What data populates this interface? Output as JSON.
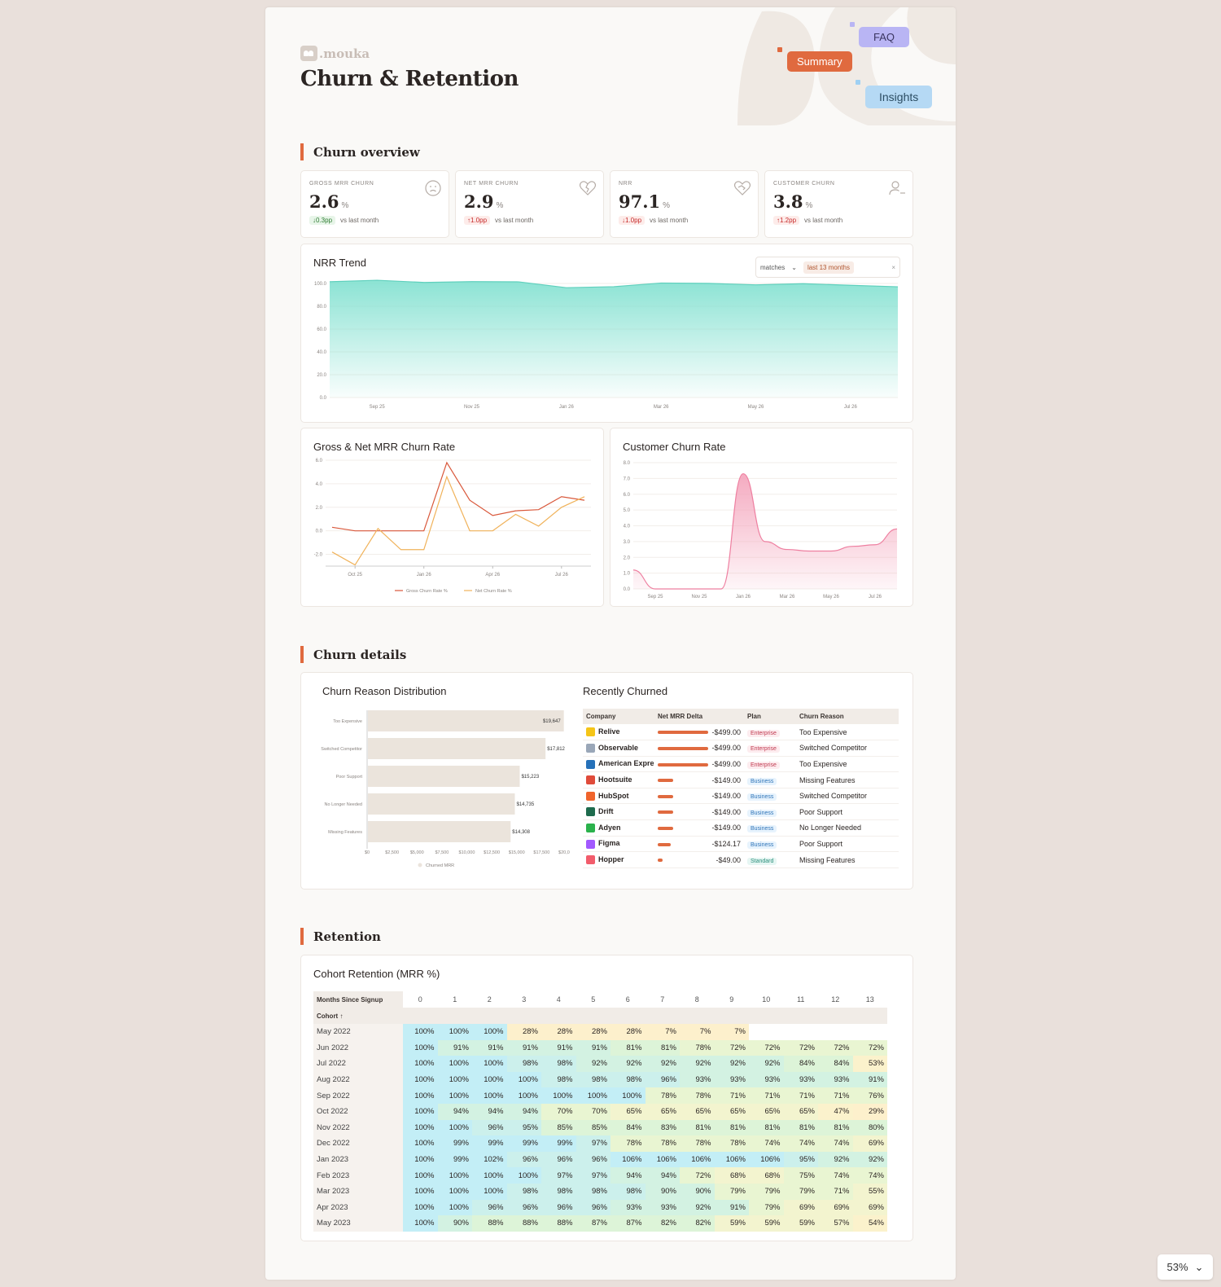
{
  "brand": {
    "name": ".mouka"
  },
  "page_title": "Churn & Retention",
  "nav_pills": {
    "summary": "Summary",
    "faq": "FAQ",
    "insights": "Insights"
  },
  "sections": {
    "overview": "Churn overview",
    "details": "Churn details",
    "retention": "Retention"
  },
  "kpis": [
    {
      "label": "GROSS MRR CHURN",
      "value": "2.6",
      "unit": "%",
      "delta": "↓0.3pp",
      "delta_tone": "good",
      "note": "vs last month",
      "icon": "sad-face-icon"
    },
    {
      "label": "NET MRR CHURN",
      "value": "2.9",
      "unit": "%",
      "delta": "↑1.0pp",
      "delta_tone": "bad",
      "note": "vs last month",
      "icon": "broken-heart-icon"
    },
    {
      "label": "NRR",
      "value": "97.1",
      "unit": "%",
      "delta": "↓1.0pp",
      "delta_tone": "bad",
      "note": "vs last month",
      "icon": "heart-handshake-icon"
    },
    {
      "label": "CUSTOMER CHURN",
      "value": "3.8",
      "unit": "%",
      "delta": "↑1.2pp",
      "delta_tone": "bad",
      "note": "vs last month",
      "icon": "user-minus-icon"
    }
  ],
  "nrr_trend": {
    "title": "NRR Trend",
    "filter_op": "matches",
    "filter_value": "last 13 months",
    "filter_clear": "×"
  },
  "churn_rate": {
    "title": "Gross & Net MRR Churn Rate"
  },
  "customer_churn": {
    "title": "Customer Churn Rate"
  },
  "reason_dist": {
    "title": "Churn Reason Distribution"
  },
  "recent": {
    "title": "Recently Churned",
    "columns": [
      "Company",
      "Net MRR Delta",
      "Plan",
      "Churn Reason"
    ],
    "rows": [
      {
        "company": "Relive",
        "delta": "-$499.00",
        "bar": 1.0,
        "plan": "Enterprise",
        "reason": "Too Expensive",
        "logo_color": "#f5c518"
      },
      {
        "company": "Observable",
        "delta": "-$499.00",
        "bar": 1.0,
        "plan": "Enterprise",
        "reason": "Switched Competitor",
        "logo_color": "#9aa7b8"
      },
      {
        "company": "American Express",
        "delta": "-$499.00",
        "bar": 1.0,
        "plan": "Enterprise",
        "reason": "Too Expensive",
        "logo_color": "#2671b9"
      },
      {
        "company": "Hootsuite",
        "delta": "-$149.00",
        "bar": 0.3,
        "plan": "Business",
        "reason": "Missing Features",
        "logo_color": "#e04b3a"
      },
      {
        "company": "HubSpot",
        "delta": "-$149.00",
        "bar": 0.3,
        "plan": "Business",
        "reason": "Switched Competitor",
        "logo_color": "#f0642c"
      },
      {
        "company": "Drift",
        "delta": "-$149.00",
        "bar": 0.3,
        "plan": "Business",
        "reason": "Poor Support",
        "logo_color": "#1e6b4d"
      },
      {
        "company": "Adyen",
        "delta": "-$149.00",
        "bar": 0.3,
        "plan": "Business",
        "reason": "No Longer Needed",
        "logo_color": "#2bb24c"
      },
      {
        "company": "Figma",
        "delta": "-$124.17",
        "bar": 0.25,
        "plan": "Business",
        "reason": "Poor Support",
        "logo_color": "#a259ff"
      },
      {
        "company": "Hopper",
        "delta": "-$49.00",
        "bar": 0.1,
        "plan": "Standard",
        "reason": "Missing Features",
        "logo_color": "#f25c6b"
      }
    ]
  },
  "cohort": {
    "title": "Cohort Retention (MRR %)",
    "header_label": "Months Since Signup",
    "cohort_label": "Cohort ↑",
    "months": [
      "0",
      "1",
      "2",
      "3",
      "4",
      "5",
      "6",
      "7",
      "8",
      "9",
      "10",
      "11",
      "12",
      "13"
    ],
    "rows": [
      {
        "cohort": "May 2022",
        "values": [
          100,
          100,
          100,
          28,
          28,
          28,
          28,
          7,
          7,
          7,
          null,
          null,
          null,
          null
        ]
      },
      {
        "cohort": "Jun 2022",
        "values": [
          100,
          91,
          91,
          91,
          91,
          91,
          81,
          81,
          78,
          72,
          72,
          72,
          72,
          72
        ]
      },
      {
        "cohort": "Jul 2022",
        "values": [
          100,
          100,
          100,
          98,
          98,
          92,
          92,
          92,
          92,
          92,
          92,
          84,
          84,
          53
        ]
      },
      {
        "cohort": "Aug 2022",
        "values": [
          100,
          100,
          100,
          100,
          98,
          98,
          98,
          96,
          93,
          93,
          93,
          93,
          93,
          91
        ]
      },
      {
        "cohort": "Sep 2022",
        "values": [
          100,
          100,
          100,
          100,
          100,
          100,
          100,
          78,
          78,
          71,
          71,
          71,
          71,
          76
        ]
      },
      {
        "cohort": "Oct 2022",
        "values": [
          100,
          94,
          94,
          94,
          70,
          70,
          65,
          65,
          65,
          65,
          65,
          65,
          47,
          29
        ]
      },
      {
        "cohort": "Nov 2022",
        "values": [
          100,
          100,
          96,
          95,
          85,
          85,
          84,
          83,
          81,
          81,
          81,
          81,
          81,
          80
        ]
      },
      {
        "cohort": "Dec 2022",
        "values": [
          100,
          99,
          99,
          99,
          99,
          97,
          78,
          78,
          78,
          78,
          74,
          74,
          74,
          69
        ]
      },
      {
        "cohort": "Jan 2023",
        "values": [
          100,
          99,
          102,
          96,
          96,
          96,
          106,
          106,
          106,
          106,
          106,
          95,
          92,
          92
        ]
      },
      {
        "cohort": "Feb 2023",
        "values": [
          100,
          100,
          100,
          100,
          97,
          97,
          94,
          94,
          72,
          68,
          68,
          75,
          74,
          74
        ]
      },
      {
        "cohort": "Mar 2023",
        "values": [
          100,
          100,
          100,
          98,
          98,
          98,
          98,
          90,
          90,
          79,
          79,
          79,
          71,
          55
        ]
      },
      {
        "cohort": "Apr 2023",
        "values": [
          100,
          100,
          96,
          96,
          96,
          96,
          93,
          93,
          92,
          91,
          79,
          69,
          69,
          69
        ]
      },
      {
        "cohort": "May 2023",
        "values": [
          100,
          90,
          88,
          88,
          88,
          87,
          87,
          82,
          82,
          59,
          59,
          59,
          57,
          54
        ]
      }
    ]
  },
  "zoom": {
    "value": "53%"
  },
  "chart_data": [
    {
      "type": "area",
      "title": "NRR Trend",
      "x_ticks": [
        "Sep 25",
        "Nov 25",
        "Jan 26",
        "Mar 26",
        "May 26",
        "Jul 26"
      ],
      "x": [
        "Aug 25",
        "Sep 25",
        "Oct 25",
        "Nov 25",
        "Dec 25",
        "Jan 26",
        "Feb 26",
        "Mar 26",
        "Apr 26",
        "May 26",
        "Jun 26",
        "Jul 26",
        "Aug 26"
      ],
      "series": [
        {
          "values": [
            101.5,
            102.8,
            100.9,
            101.6,
            101.4,
            96.3,
            97.2,
            100.4,
            100.1,
            98.8,
            99.8,
            98.4,
            97.1
          ]
        }
      ],
      "y_ticks": [
        "0.0",
        "20.0",
        "40.0",
        "60.0",
        "80.0",
        "100.0"
      ],
      "ylim": [
        0,
        100
      ],
      "color": "#7fe0cf",
      "grid": true
    },
    {
      "type": "line",
      "title": "Gross & Net MRR Churn Rate",
      "x_ticks": [
        "Oct 25",
        "Jan 26",
        "Apr 26",
        "Jul 26"
      ],
      "x": [
        "Sep 25",
        "Oct 25",
        "Nov 25",
        "Dec 25",
        "Jan 26",
        "Feb 26",
        "Mar 26",
        "Apr 26",
        "May 26",
        "Jun 26",
        "Jul 26",
        "Aug 26"
      ],
      "series": [
        {
          "name": "Gross Churn Rate %",
          "color": "#d9583b",
          "values": [
            0.3,
            0.0,
            0.0,
            0.0,
            0.0,
            5.8,
            2.6,
            1.3,
            1.7,
            1.8,
            2.9,
            2.6
          ]
        },
        {
          "name": "Net Churn Rate %",
          "color": "#f0b25a",
          "values": [
            -1.8,
            -2.9,
            0.2,
            -1.6,
            -1.6,
            4.6,
            0.0,
            0.0,
            1.4,
            0.4,
            2.0,
            2.9
          ]
        }
      ],
      "y_ticks": [
        "-2.0",
        "0.0",
        "2.0",
        "4.0",
        "6.0"
      ],
      "ylim": [
        -3,
        6
      ],
      "legend": "bottom"
    },
    {
      "type": "area",
      "title": "Customer Churn Rate",
      "x_ticks": [
        "Sep 25",
        "Nov 25",
        "Jan 26",
        "Mar 26",
        "May 26",
        "Jul 26"
      ],
      "x": [
        "Aug 25",
        "Sep 25",
        "Oct 25",
        "Nov 25",
        "Dec 25",
        "Jan 26",
        "Feb 26",
        "Mar 26",
        "Apr 26",
        "May 26",
        "Jun 26",
        "Jul 26",
        "Aug 26"
      ],
      "series": [
        {
          "values": [
            1.2,
            0.0,
            0.0,
            0.0,
            0.0,
            7.3,
            3.0,
            2.5,
            2.4,
            2.4,
            2.7,
            2.8,
            3.8
          ]
        }
      ],
      "y_ticks": [
        "0.0",
        "1.0",
        "2.0",
        "3.0",
        "4.0",
        "5.0",
        "6.0",
        "7.0",
        "8.0"
      ],
      "ylim": [
        0,
        8
      ],
      "color": "#f4a6bd"
    },
    {
      "type": "bar",
      "orientation": "horizontal",
      "title": "Churn Reason Distribution",
      "categories": [
        "Too Expensive",
        "Switched Competitor",
        "Poor Support",
        "No Longer Needed",
        "Missing Features"
      ],
      "values": [
        19647,
        17812,
        15223,
        14735,
        14308
      ],
      "value_labels": [
        "$19,647",
        "$17,812",
        "$15,223",
        "$14,735",
        "$14,308"
      ],
      "x_ticks": [
        "$0",
        "$2,500",
        "$5,000",
        "$7,500",
        "$10,000",
        "$12,500",
        "$15,000",
        "$17,500",
        "$20,000"
      ],
      "xlim": [
        0,
        20000
      ],
      "legend": "Churned MRR",
      "color": "#ebe4dc"
    }
  ]
}
